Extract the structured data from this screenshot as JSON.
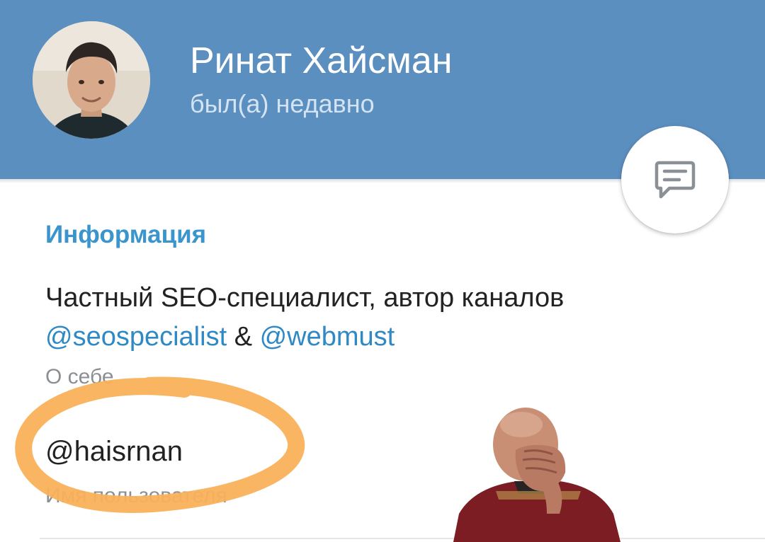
{
  "profile": {
    "name": "Ринат Хайсман",
    "status": "был(а) недавно"
  },
  "info": {
    "section_title": "Информация",
    "bio_text": "Частный SEO-специалист, автор каналов",
    "bio_link_1": "@seospecialist",
    "bio_separator": " & ",
    "bio_link_2": "@webmust",
    "bio_caption": "О себе",
    "username": "@haisrnan",
    "username_caption": "Имя пользователя"
  },
  "icons": {
    "message_button": "message-icon"
  },
  "colors": {
    "header": "#5b8fc0",
    "accent": "#3a95cd",
    "link": "#2f89c5",
    "highlight": "#f9b15a"
  }
}
